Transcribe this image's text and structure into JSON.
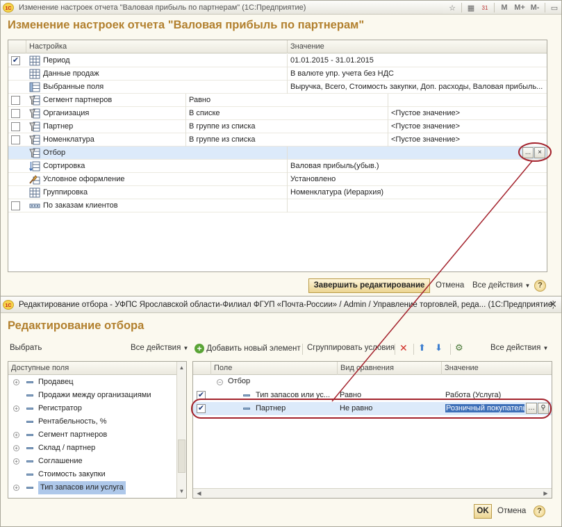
{
  "win1": {
    "title": "Изменение настроек отчета \"Валовая прибыль по партнерам\"  (1С:Предприятие)",
    "heading": "Изменение настроек отчета \"Валовая прибыль по партнерам\"",
    "titlebar_buttons": [
      "M",
      "M+",
      "M-"
    ],
    "columns": [
      "Настройка",
      "Значение"
    ],
    "rows": [
      {
        "checkbox": true,
        "checked": true,
        "icon": "table-icon",
        "name": "Период",
        "value": "01.01.2015 - 31.01.2015"
      },
      {
        "checkbox": false,
        "icon": "table-icon",
        "name": "Данные продаж",
        "value": "В валюте упр. учета без НДС"
      },
      {
        "checkbox": false,
        "icon": "fields-icon",
        "name": "Выбранные поля",
        "value": "Выручка, Всего, Стоимость закупки, Доп. расходы, Валовая прибыль..."
      },
      {
        "checkbox": true,
        "checked": false,
        "icon": "filter-icon",
        "name": "Сегмент партнеров",
        "comparison": "Равно",
        "value": ""
      },
      {
        "checkbox": true,
        "checked": false,
        "icon": "filter-icon",
        "name": "Организация",
        "comparison": "В списке",
        "value": "<Пустое значение>"
      },
      {
        "checkbox": true,
        "checked": false,
        "icon": "filter-icon",
        "name": "Партнер",
        "comparison": "В группе из списка",
        "value": "<Пустое значение>"
      },
      {
        "checkbox": true,
        "checked": false,
        "icon": "filter-icon",
        "name": "Номенклатура",
        "comparison": "В группе из списка",
        "value": "<Пустое значение>"
      },
      {
        "checkbox": false,
        "icon": "filter-icon",
        "name": "Отбор",
        "value": "",
        "selected": true
      },
      {
        "checkbox": false,
        "icon": "sort-icon",
        "name": "Сортировка",
        "value": "Валовая прибыль(убыв.)"
      },
      {
        "checkbox": false,
        "icon": "brush-icon",
        "name": "Условное оформление",
        "value": "Установлено"
      },
      {
        "checkbox": false,
        "icon": "table-icon",
        "name": "Группировка",
        "value": "Номенклатура (Иерархия)"
      },
      {
        "checkbox": true,
        "checked": false,
        "icon": "field-icon",
        "name": "По заказам клиентов",
        "value": ""
      }
    ],
    "select_button": "...",
    "clear_button": "×",
    "finish_button": "Завершить редактирование",
    "cancel_link": "Отмена",
    "all_actions": "Все действия",
    "help": "?"
  },
  "win2": {
    "title": "Редактирование отбора - УФПС Ярославской области-Филиал ФГУП «Почта-России» / Admin / Управление торговлей, реда...  (1С:Предприятие)",
    "heading": "Редактирование отбора",
    "toolbar": {
      "choose": "Выбрать",
      "all_actions_left": "Все действия",
      "add_new": "Добавить новый элемент",
      "group": "Сгруппировать условия",
      "all_actions_right": "Все действия"
    },
    "available_fields_header": "Доступные поля",
    "available_fields": [
      {
        "label": "Продавец",
        "expandable": true
      },
      {
        "label": "Продажи между организациями",
        "expandable": false
      },
      {
        "label": "Регистратор",
        "expandable": true
      },
      {
        "label": "Рентабельность, %",
        "expandable": false
      },
      {
        "label": "Сегмент партнеров",
        "expandable": true
      },
      {
        "label": "Склад / партнер",
        "expandable": true
      },
      {
        "label": "Соглашение",
        "expandable": true
      },
      {
        "label": "Стоимость закупки",
        "expandable": false
      },
      {
        "label": "Тип запасов или услуга",
        "expandable": true,
        "selected": true
      }
    ],
    "filter_columns": [
      "Поле",
      "Вид сравнения",
      "Значение"
    ],
    "filter_root": "Отбор",
    "filter_rows": [
      {
        "checked": true,
        "field": "Тип запасов или ус...",
        "comparison": "Равно",
        "value": "Работа (Услуга)"
      },
      {
        "checked": true,
        "field": "Партнер",
        "comparison": "Не равно",
        "value": "Розничный покупатель",
        "selected": true
      }
    ],
    "ok_button": "OK",
    "cancel_link": "Отмена",
    "help": "?"
  },
  "colors": {
    "heading": "#b2802e",
    "selection": "#dceafa",
    "annotation": "#a3212b"
  }
}
